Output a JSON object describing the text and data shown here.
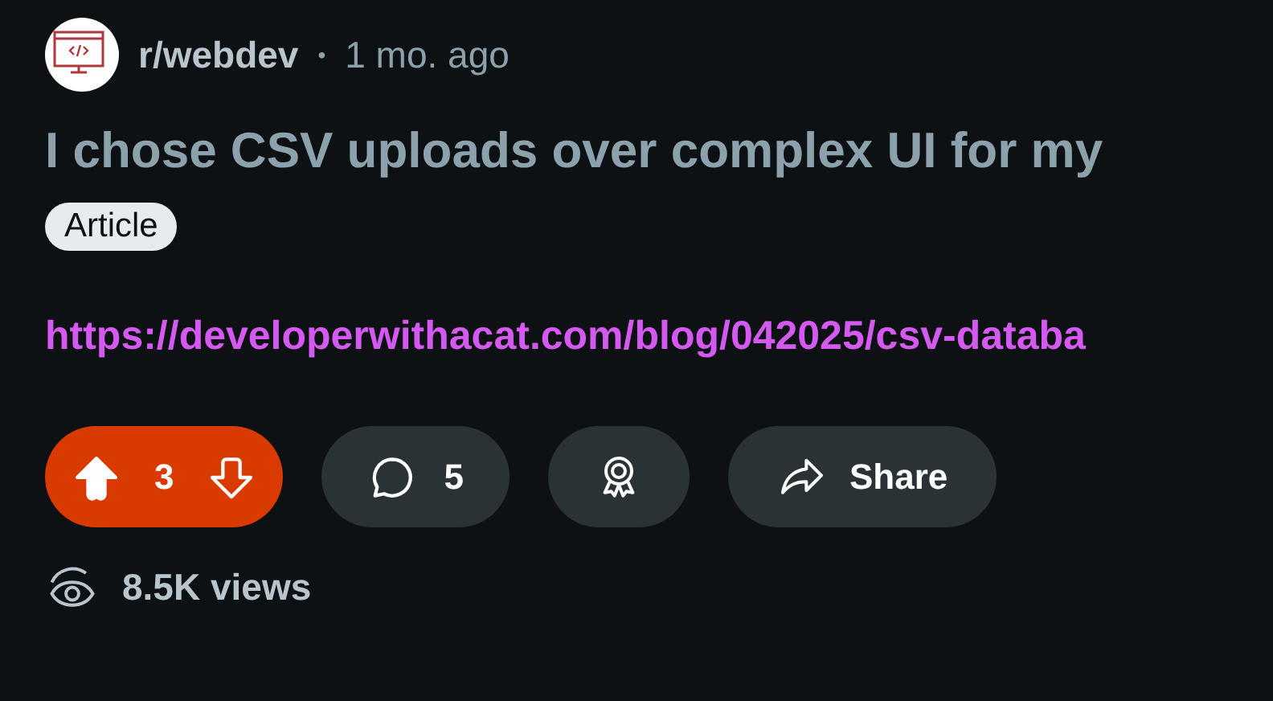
{
  "post": {
    "subreddit": "r/webdev",
    "separator": "•",
    "time": "1 mo. ago",
    "title": "I chose CSV uploads over complex UI for my",
    "flair": "Article",
    "link": "https://developerwithacat.com/blog/042025/csv-databa"
  },
  "actions": {
    "upvoted": true,
    "score": "3",
    "comments": "5",
    "share": "Share"
  },
  "views": "8.5K views"
}
